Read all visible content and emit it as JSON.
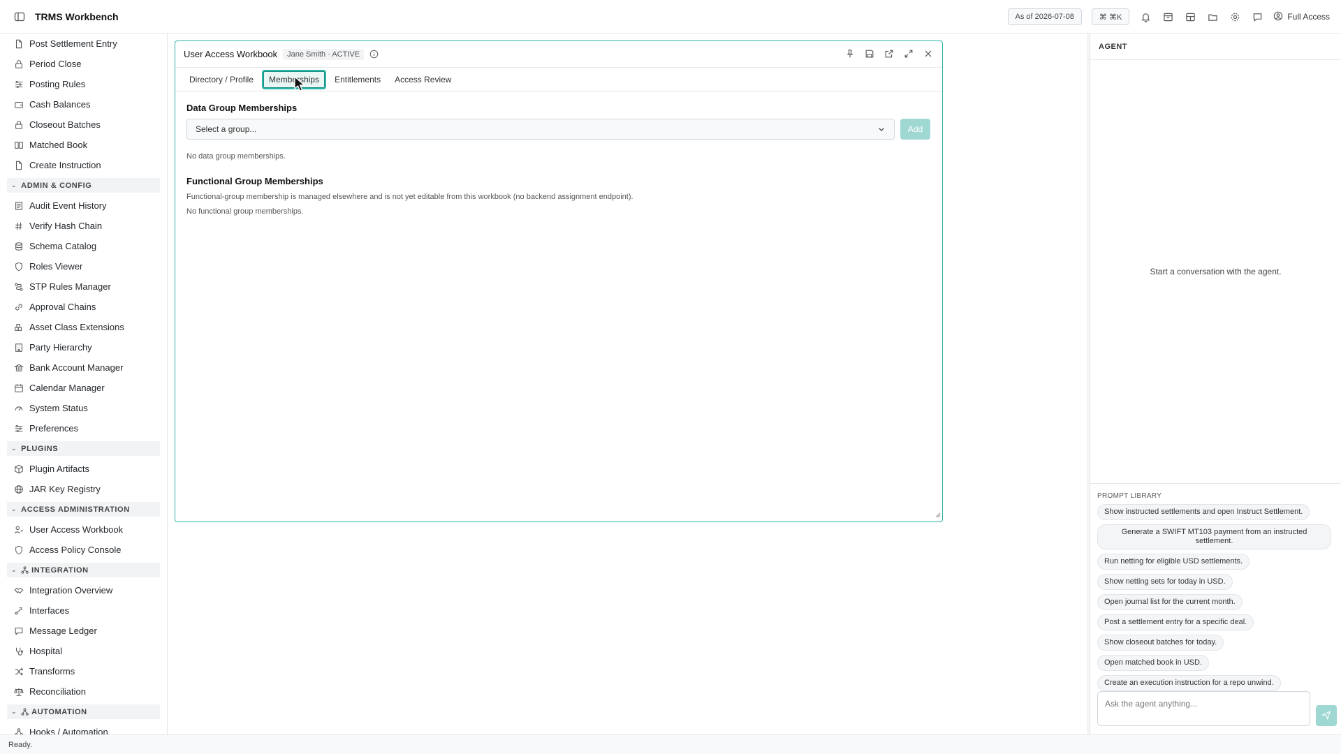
{
  "header": {
    "app_title": "TRMS Workbench",
    "as_of": "As of 2026-07-08",
    "shortcut": "⌘ ⌘K",
    "access": "Full Access"
  },
  "sidebar": {
    "items_top": [
      {
        "label": "Post Settlement Entry",
        "icon": "file-icon"
      },
      {
        "label": "Period Close",
        "icon": "lock-icon"
      },
      {
        "label": "Posting Rules",
        "icon": "sliders-icon"
      },
      {
        "label": "Cash Balances",
        "icon": "wallet-icon"
      },
      {
        "label": "Closeout Batches",
        "icon": "lock-icon"
      },
      {
        "label": "Matched Book",
        "icon": "book-icon"
      },
      {
        "label": "Create Instruction",
        "icon": "file-icon"
      }
    ],
    "section_admin": "ADMIN & CONFIG",
    "items_admin": [
      {
        "label": "Audit Event History",
        "icon": "history-icon"
      },
      {
        "label": "Verify Hash Chain",
        "icon": "hash-icon"
      },
      {
        "label": "Schema Catalog",
        "icon": "database-icon"
      },
      {
        "label": "Roles Viewer",
        "icon": "shield-icon"
      },
      {
        "label": "STP Rules Manager",
        "icon": "route-icon"
      },
      {
        "label": "Approval Chains",
        "icon": "chain-icon"
      },
      {
        "label": "Asset Class Extensions",
        "icon": "blocks-icon"
      },
      {
        "label": "Party Hierarchy",
        "icon": "building-icon"
      },
      {
        "label": "Bank Account Manager",
        "icon": "bank-icon"
      },
      {
        "label": "Calendar Manager",
        "icon": "calendar-icon"
      },
      {
        "label": "System Status",
        "icon": "gauge-icon"
      },
      {
        "label": "Preferences",
        "icon": "sliders-icon"
      }
    ],
    "section_plugins": "PLUGINS",
    "items_plugins": [
      {
        "label": "Plugin Artifacts",
        "icon": "package-icon"
      },
      {
        "label": "JAR Key Registry",
        "icon": "globe-icon"
      }
    ],
    "section_access": "ACCESS ADMINISTRATION",
    "items_access": [
      {
        "label": "User Access Workbook",
        "icon": "user-key-icon"
      },
      {
        "label": "Access Policy Console",
        "icon": "shield-icon"
      }
    ],
    "section_integration": "INTEGRATION",
    "items_integration": [
      {
        "label": "Integration Overview",
        "icon": "handshake-icon"
      },
      {
        "label": "Interfaces",
        "icon": "interface-icon"
      },
      {
        "label": "Message Ledger",
        "icon": "ledger-icon"
      },
      {
        "label": "Hospital",
        "icon": "stethoscope-icon"
      },
      {
        "label": "Transforms",
        "icon": "shuffle-icon"
      },
      {
        "label": "Reconciliation",
        "icon": "scale-icon"
      }
    ],
    "section_automation": "AUTOMATION",
    "items_automation": [
      {
        "label": "Hooks / Automation",
        "icon": "webhook-icon"
      }
    ]
  },
  "panel": {
    "title": "User Access Workbook",
    "badge": "Jane Smith · ACTIVE",
    "tabs": [
      "Directory / Profile",
      "Memberships",
      "Entitlements",
      "Access Review"
    ],
    "active_tab": "Memberships",
    "data_groups_title": "Data Group Memberships",
    "select_placeholder": "Select a group...",
    "add_label": "Add",
    "no_data_groups": "No data group memberships.",
    "functional_title": "Functional Group Memberships",
    "functional_note": "Functional-group membership is managed elsewhere and is not yet editable from this workbook (no backend assignment endpoint).",
    "no_functional": "No functional group memberships."
  },
  "agent": {
    "title": "AGENT",
    "empty": "Start a conversation with the agent.",
    "prompt_library_label": "PROMPT LIBRARY",
    "prompts": [
      "Show instructed settlements and open Instruct Settlement.",
      "Generate a SWIFT MT103 payment from an instructed settlement.",
      "Run netting for eligible USD settlements.",
      "Show netting sets for today in USD.",
      "Open journal list for the current month.",
      "Post a settlement entry for a specific deal.",
      "Show closeout batches for today.",
      "Open matched book in USD.",
      "Create an execution instruction for a repo unwind."
    ],
    "input_placeholder": "Ask the agent anything..."
  },
  "status": {
    "text": "Ready."
  }
}
